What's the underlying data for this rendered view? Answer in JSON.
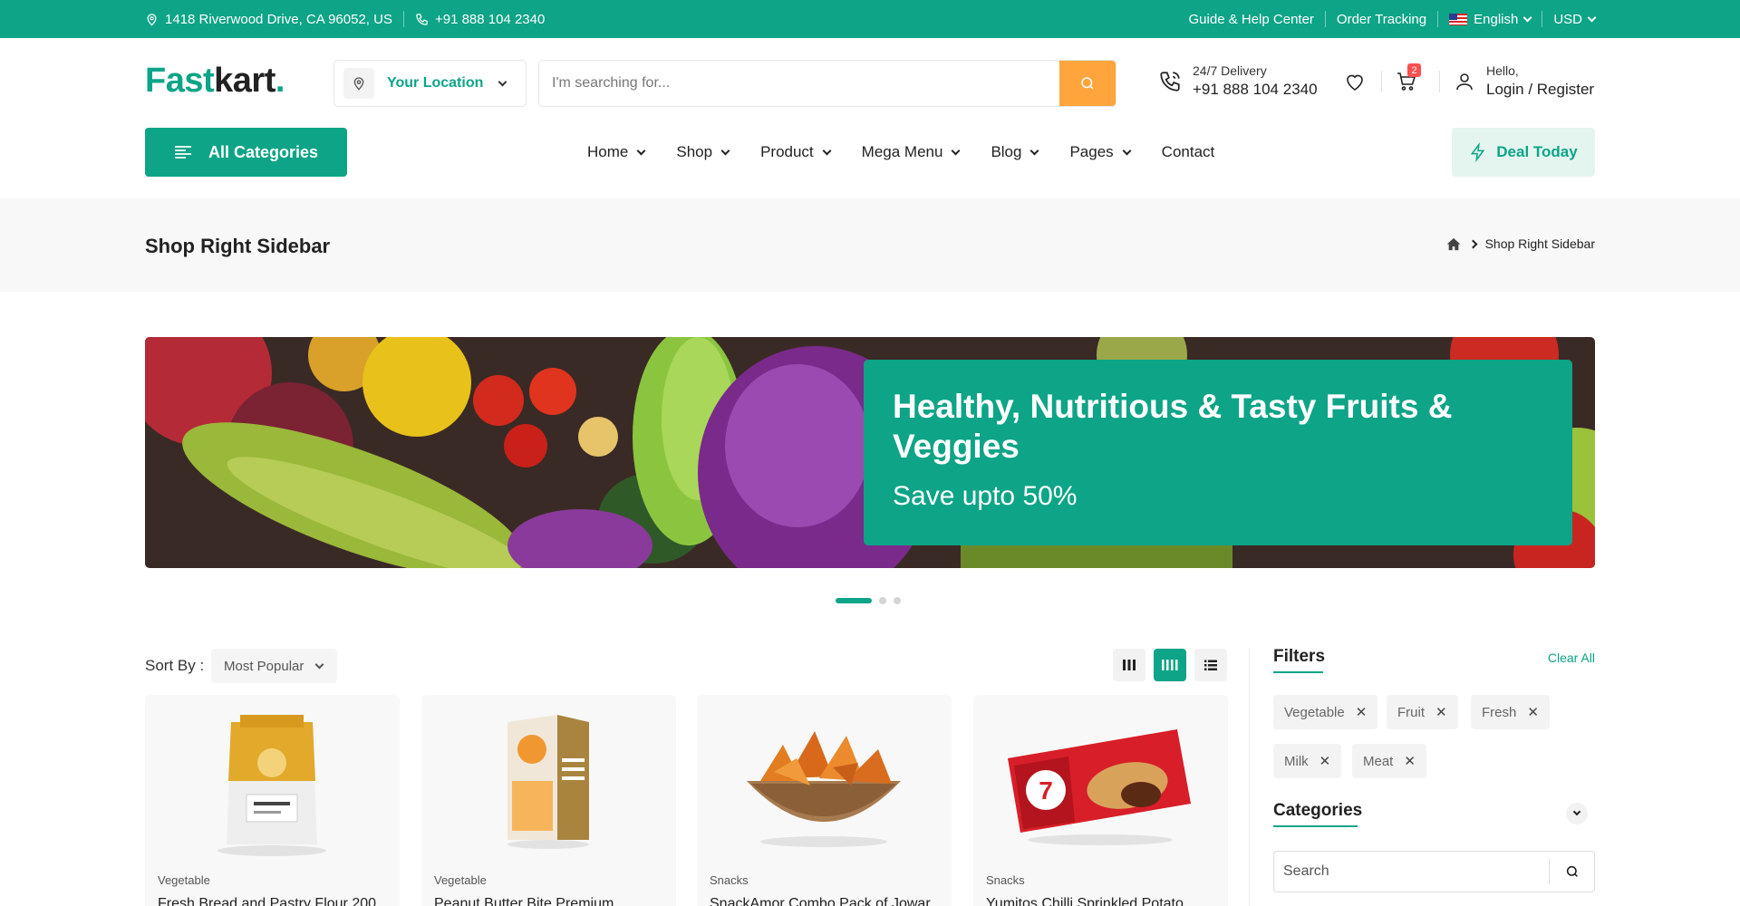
{
  "topbar": {
    "address": "1418 Riverwood Drive, CA 96052, US",
    "phone": "+91 888 104 2340",
    "help": "Guide & Help Center",
    "tracking": "Order Tracking",
    "language": "English",
    "currency": "USD"
  },
  "header": {
    "logo_main": "Fast",
    "logo_accent": "kart",
    "logo_dot": ".",
    "location_label": "Your Location",
    "search_placeholder": "I'm searching for...",
    "delivery_label": "24/7 Delivery",
    "delivery_phone": "+91 888 104 2340",
    "cart_count": "2",
    "greeting": "Hello,",
    "login_label": "Login / Register"
  },
  "nav": {
    "all_categories": "All Categories",
    "items": [
      "Home",
      "Shop",
      "Product",
      "Mega Menu",
      "Blog",
      "Pages",
      "Contact"
    ],
    "deal_label": "Deal Today"
  },
  "page": {
    "title": "Shop Right Sidebar",
    "breadcrumb_current": "Shop Right Sidebar"
  },
  "banner": {
    "headline": "Healthy, Nutritious & Tasty Fruits & Veggies",
    "subline": "Save upto 50%",
    "active_slide": 1,
    "slide_count": 3
  },
  "toolbar": {
    "sort_label": "Sort By :",
    "sort_value": "Most Popular",
    "active_view": "grid-4"
  },
  "products": [
    {
      "category": "Vegetable",
      "name": "Fresh Bread and Pastry Flour 200"
    },
    {
      "category": "Vegetable",
      "name": "Peanut Butter Bite Premium"
    },
    {
      "category": "Snacks",
      "name": "SnackAmor Combo Pack of Jowar"
    },
    {
      "category": "Snacks",
      "name": "Yumitos Chilli Sprinkled Potato"
    }
  ],
  "sidebar": {
    "filters_title": "Filters",
    "clear_all": "Clear All",
    "active_filters": [
      "Vegetable",
      "Fruit",
      "Fresh",
      "Milk",
      "Meat"
    ],
    "categories_title": "Categories",
    "category_search_placeholder": "Search"
  },
  "colors": {
    "primary": "#0da487",
    "accent": "#ffa53b",
    "badge": "#ff4f4f"
  }
}
